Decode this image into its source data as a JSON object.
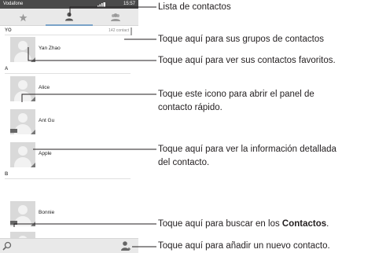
{
  "status": {
    "carrier": "Vodafone",
    "time": "15:57"
  },
  "tabs": [
    {
      "icon": "star-icon"
    },
    {
      "icon": "contacts-icon"
    },
    {
      "icon": "groups-icon"
    }
  ],
  "list": {
    "count": "142 contact",
    "sections": [
      "YO",
      "A",
      "B"
    ],
    "contacts": [
      "Yan Zhao",
      "Alice",
      "Ant Gu",
      "Apple",
      "Bonnie"
    ]
  },
  "callouts": {
    "c1": "Lista de contactos",
    "c2": "Toque aquí para sus grupos de contactos",
    "c3": "Toque aquí para ver sus contactos favoritos.",
    "c4_line1": "Toque este icono para abrir el panel de",
    "c4_line2": "contacto rápido.",
    "c5_line1": "Toque aquí para ver la información detallada",
    "c5_line2": "del contacto.",
    "c6_pre": "Toque aquí para buscar en los ",
    "c6_bold": "Contactos",
    "c6_post": ".",
    "c7": "Toque aquí para añadir un nuevo contacto."
  },
  "colors": {
    "statusbar": "#4a4a4a",
    "tab_indicator": "#7aa3c8"
  }
}
